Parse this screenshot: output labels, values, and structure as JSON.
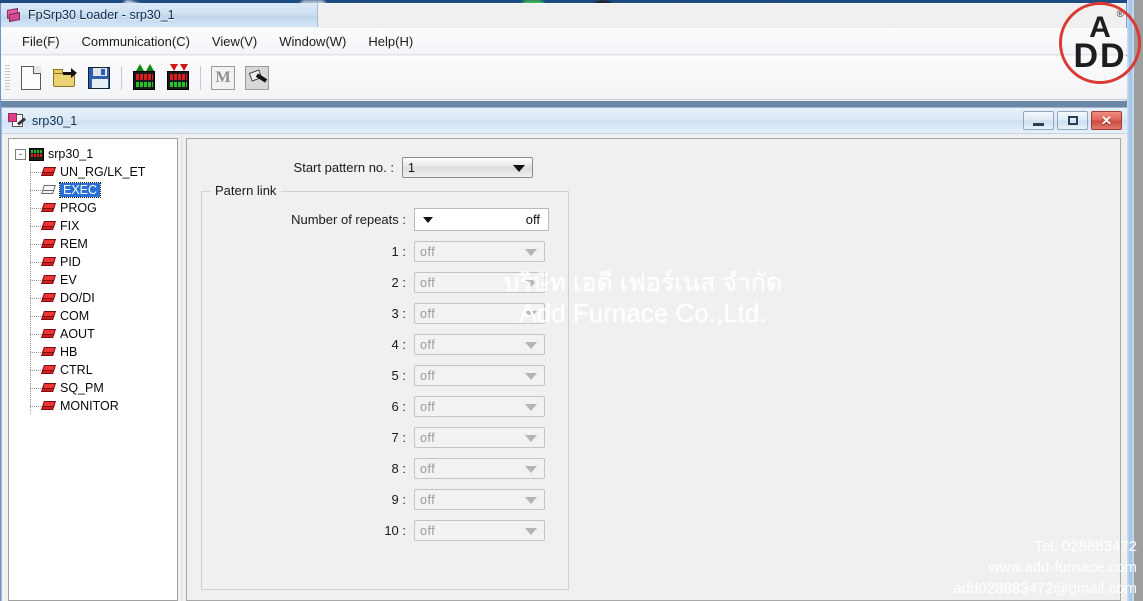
{
  "app": {
    "title": "FpSrp30 Loader - srp30_1",
    "icon": "app-books-icon"
  },
  "menu": {
    "items": [
      {
        "label": "File(F)"
      },
      {
        "label": "Communication(C)"
      },
      {
        "label": "View(V)"
      },
      {
        "label": "Window(W)"
      },
      {
        "label": "Help(H)"
      }
    ]
  },
  "toolbar": {
    "buttons": [
      {
        "name": "new-file-icon"
      },
      {
        "name": "open-file-icon"
      },
      {
        "name": "save-file-icon"
      },
      {
        "name": "upload-to-device-icon"
      },
      {
        "name": "download-from-device-icon"
      },
      {
        "name": "monitor-icon"
      },
      {
        "name": "tools-icon"
      }
    ]
  },
  "child_window": {
    "title": "srp30_1",
    "minimize_label": "–",
    "maximize_label": "□",
    "close_label": "✕"
  },
  "tree": {
    "root": {
      "label": "srp30_1",
      "expander": "-"
    },
    "items": [
      {
        "label": "UN_RG/LK_ET",
        "selected": false
      },
      {
        "label": "EXEC",
        "selected": true
      },
      {
        "label": "PROG",
        "selected": false
      },
      {
        "label": "FIX",
        "selected": false
      },
      {
        "label": "REM",
        "selected": false
      },
      {
        "label": "PID",
        "selected": false
      },
      {
        "label": "EV",
        "selected": false
      },
      {
        "label": "DO/DI",
        "selected": false
      },
      {
        "label": "COM",
        "selected": false
      },
      {
        "label": "AOUT",
        "selected": false
      },
      {
        "label": "HB",
        "selected": false
      },
      {
        "label": "CTRL",
        "selected": false
      },
      {
        "label": "SQ_PM",
        "selected": false
      },
      {
        "label": "MONITOR",
        "selected": false
      }
    ]
  },
  "form": {
    "start_pattern": {
      "label": "Start pattern no. :",
      "value": "1"
    },
    "group": {
      "title": "Patern link",
      "repeats": {
        "label": "Number of repeats :",
        "value": "off"
      },
      "links": [
        {
          "label": "1 :",
          "value": "off"
        },
        {
          "label": "2 :",
          "value": "off"
        },
        {
          "label": "3 :",
          "value": "off"
        },
        {
          "label": "4 :",
          "value": "off"
        },
        {
          "label": "5 :",
          "value": "off"
        },
        {
          "label": "6 :",
          "value": "off"
        },
        {
          "label": "7 :",
          "value": "off"
        },
        {
          "label": "8 :",
          "value": "off"
        },
        {
          "label": "9 :",
          "value": "off"
        },
        {
          "label": "10 :",
          "value": "off"
        }
      ]
    }
  },
  "watermark": {
    "thai_line1": "บริษัท เอดี เฟอร์เนส จำกัด",
    "thai_line2": "Add Furnace Co.,Ltd.",
    "tel": "Tel: 028883472",
    "website": "www.add-furnace.com",
    "email": "add028883472@gmail.com"
  },
  "logo": {
    "top": "A",
    "bottom": "DD",
    "registered": "®",
    "color": "#d93b34"
  }
}
